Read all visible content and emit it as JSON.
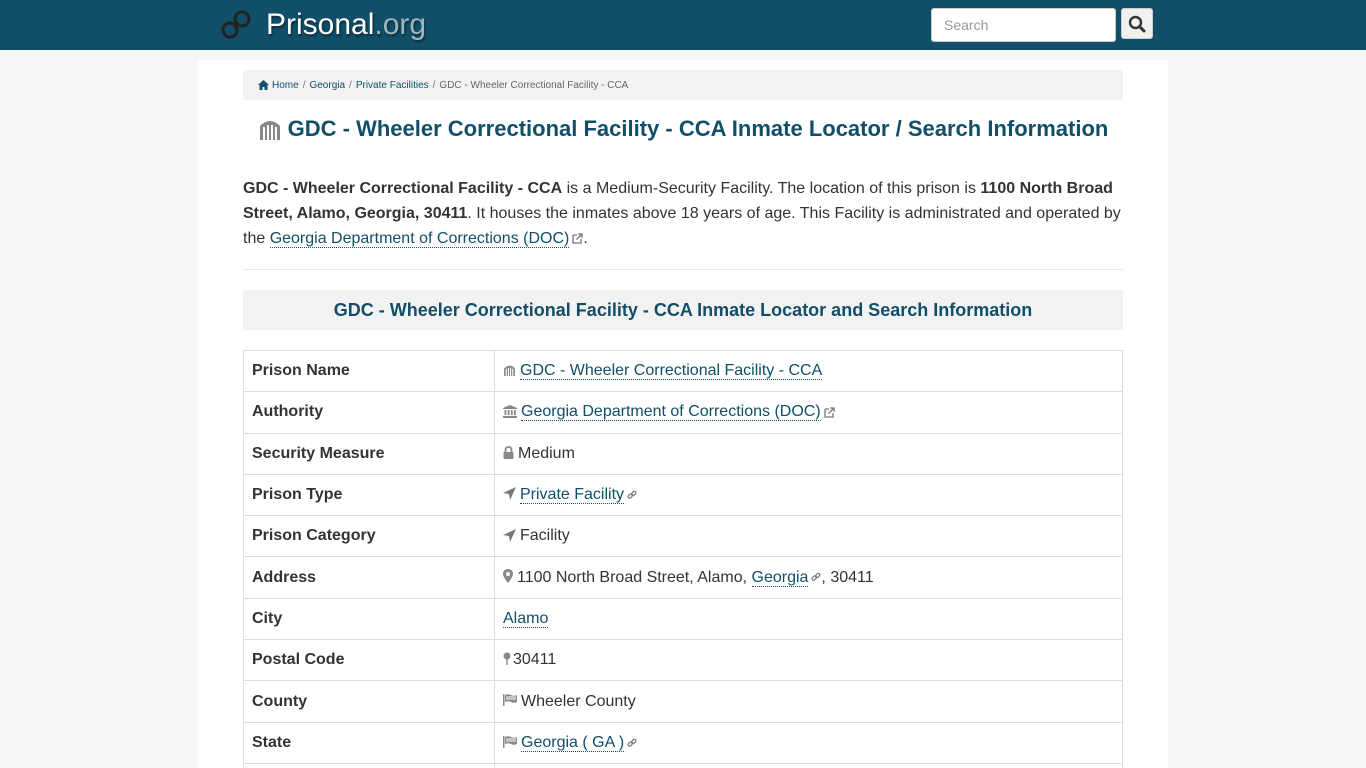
{
  "header": {
    "logo_main": "Prisonal",
    "logo_tld": ".org",
    "search_placeholder": "Search"
  },
  "breadcrumb": {
    "home": "Home",
    "state": "Georgia",
    "category": "Private Facilities",
    "current": "GDC - Wheeler Correctional Facility - CCA"
  },
  "page_title": "GDC - Wheeler Correctional Facility - CCA Inmate Locator / Search Information",
  "intro": {
    "facility": "GDC - Wheeler Correctional Facility - CCA",
    "text1": " is a Medium-Security Facility. The location of this prison is ",
    "address": "1100 North Broad Street, Alamo, Georgia, 30411",
    "text2": ". It houses the inmates above 18 years of age. This Facility is administrated and operated by the ",
    "authority_link": "Georgia Department of Corrections (DOC)",
    "text3": "."
  },
  "section_heading": "GDC - Wheeler Correctional Facility - CCA Inmate Locator and Search Information",
  "table": {
    "prison_name_label": "Prison Name",
    "prison_name": "GDC - Wheeler Correctional Facility - CCA",
    "authority_label": "Authority",
    "authority": "Georgia Department of Corrections (DOC)",
    "security_label": "Security Measure",
    "security": "Medium",
    "type_label": "Prison Type",
    "type": "Private Facility",
    "category_label": "Prison Category",
    "category": "Facility",
    "address_label": "Address",
    "address_street": "1100 North Broad Street, Alamo, ",
    "address_state": "Georgia",
    "address_zip": ", 30411",
    "city_label": "City",
    "city": "Alamo",
    "postal_label": "Postal Code",
    "postal": "30411",
    "county_label": "County",
    "county": "Wheeler County",
    "state_label": "State",
    "state": "Georgia ( GA )"
  },
  "colors": {
    "brand": "#114e68",
    "link": "#114e68",
    "muted_bg": "#f2f2f2"
  },
  "icons": [
    "prison-logo-icon",
    "search-icon",
    "home-icon",
    "prison-building-icon",
    "bank-icon",
    "lock-icon",
    "location-arrow-icon",
    "map-marker-icon",
    "map-pin-icon",
    "flag-icon",
    "external-link-icon",
    "link-icon"
  ]
}
